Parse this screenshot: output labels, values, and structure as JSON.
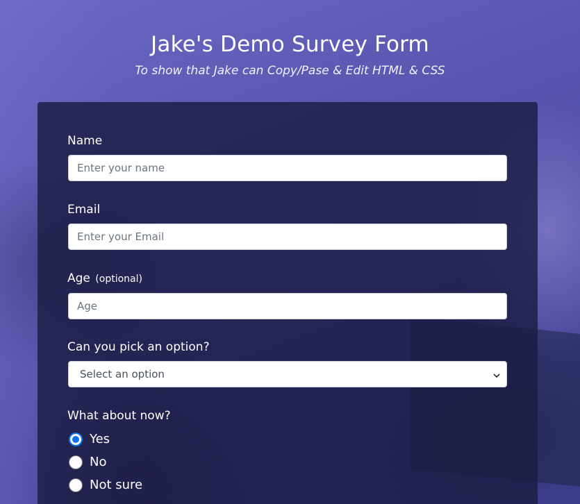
{
  "header": {
    "title": "Jake's Demo Survey Form",
    "subtitle": "To show that Jake can Copy/Pase & Edit HTML & CSS"
  },
  "form": {
    "name": {
      "label": "Name",
      "placeholder": "Enter your name",
      "value": ""
    },
    "email": {
      "label": "Email",
      "placeholder": "Enter your Email",
      "value": ""
    },
    "age": {
      "label": "Age",
      "clue": "(optional)",
      "placeholder": "Age",
      "value": ""
    },
    "dropdown": {
      "label": "Can you pick an option?",
      "selected": "Select an option",
      "icon": "chevron-down-icon"
    },
    "radio_group": {
      "label": "What about now?",
      "options": [
        {
          "label": "Yes",
          "checked": true
        },
        {
          "label": "No",
          "checked": false
        },
        {
          "label": "Not sure",
          "checked": false
        }
      ]
    }
  },
  "colors": {
    "accent": "#0b74e8",
    "card_background": "#1b1c42",
    "page_background": "#5b58ad"
  }
}
